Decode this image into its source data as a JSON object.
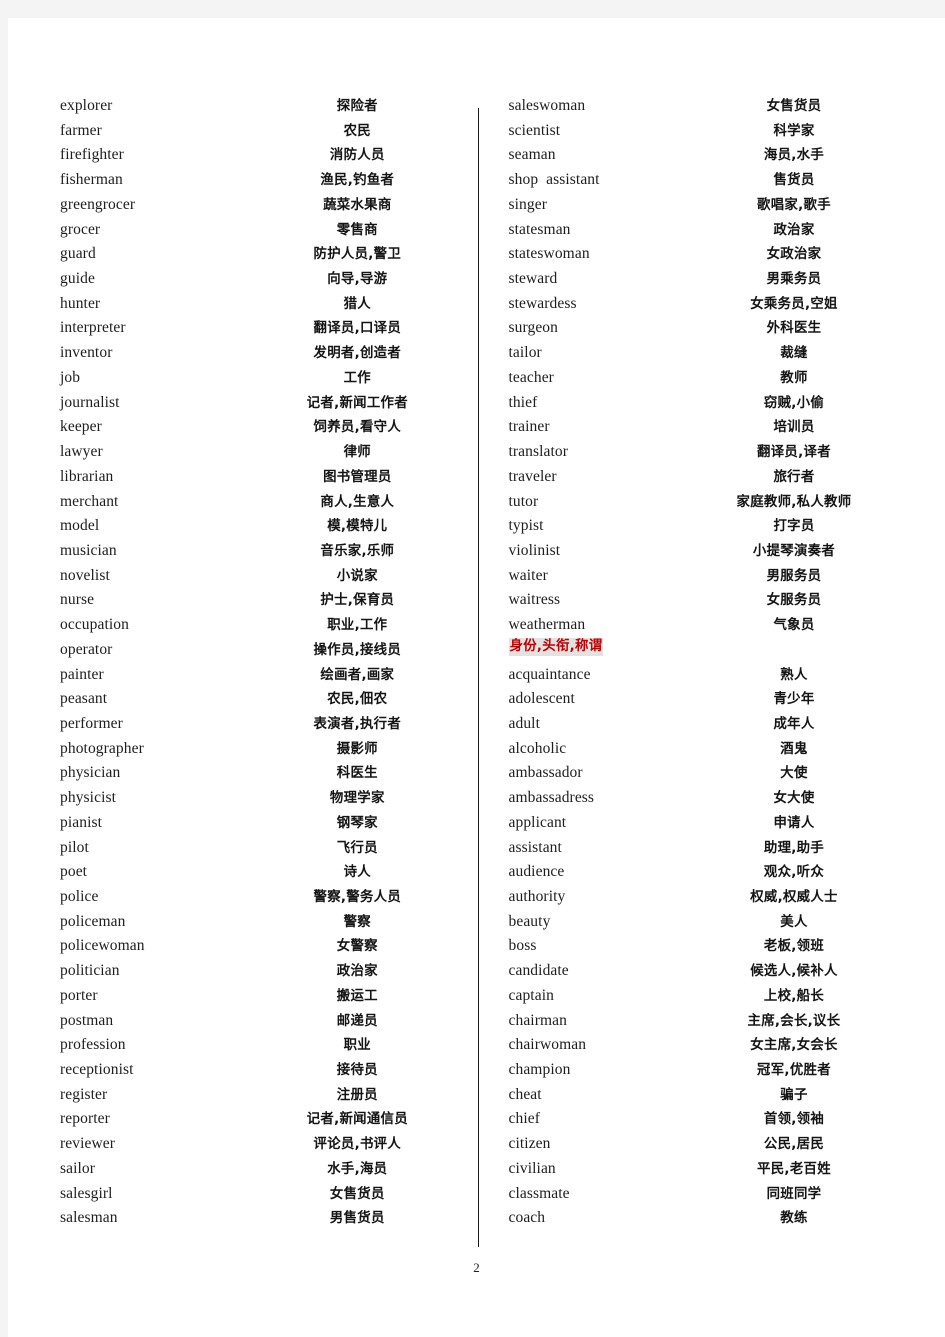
{
  "document": {
    "page_number": "2",
    "section_header": {
      "text": "身份,头衔,称谓",
      "color": "#c00000",
      "highlight": "#e2e2e2"
    }
  },
  "left_column": [
    {
      "term": "explorer",
      "gloss": "探险者"
    },
    {
      "term": "farmer",
      "gloss": "农民"
    },
    {
      "term": "firefighter",
      "gloss": "消防人员"
    },
    {
      "term": "fisherman",
      "gloss": "渔民,钓鱼者"
    },
    {
      "term": "greengrocer",
      "gloss": "蔬菜水果商"
    },
    {
      "term": "grocer",
      "gloss": "零售商"
    },
    {
      "term": "guard",
      "gloss": "防护人员,警卫"
    },
    {
      "term": "guide",
      "gloss": "向导,导游"
    },
    {
      "term": "hunter",
      "gloss": "猎人"
    },
    {
      "term": "interpreter",
      "gloss": "翻译员,口译员"
    },
    {
      "term": "inventor",
      "gloss": "发明者,创造者"
    },
    {
      "term": "job",
      "gloss": "工作"
    },
    {
      "term": "journalist",
      "gloss": "记者,新闻工作者"
    },
    {
      "term": "keeper",
      "gloss": "饲养员,看守人"
    },
    {
      "term": "lawyer",
      "gloss": "律师"
    },
    {
      "term": "librarian",
      "gloss": "图书管理员"
    },
    {
      "term": "merchant",
      "gloss": "商人,生意人"
    },
    {
      "term": "model",
      "gloss": "模,模特儿"
    },
    {
      "term": "musician",
      "gloss": "音乐家,乐师"
    },
    {
      "term": "novelist",
      "gloss": "小说家"
    },
    {
      "term": "nurse",
      "gloss": "护士,保育员"
    },
    {
      "term": "occupation",
      "gloss": "职业,工作"
    },
    {
      "term": "operator",
      "gloss": "操作员,接线员"
    },
    {
      "term": "painter",
      "gloss": "绘画者,画家"
    },
    {
      "term": "peasant",
      "gloss": "农民,佃农"
    },
    {
      "term": "performer",
      "gloss": "表演者,执行者"
    },
    {
      "term": "photographer",
      "gloss": "摄影师"
    },
    {
      "term": "physician",
      "gloss": "科医生"
    },
    {
      "term": "physicist",
      "gloss": "物理学家"
    },
    {
      "term": "pianist",
      "gloss": "钢琴家"
    },
    {
      "term": "pilot",
      "gloss": "飞行员"
    },
    {
      "term": "poet",
      "gloss": "诗人"
    },
    {
      "term": "police",
      "gloss": "警察,警务人员"
    },
    {
      "term": "policeman",
      "gloss": "警察"
    },
    {
      "term": "policewoman",
      "gloss": "女警察"
    },
    {
      "term": "politician",
      "gloss": "政治家"
    },
    {
      "term": "porter",
      "gloss": "搬运工"
    },
    {
      "term": "postman",
      "gloss": "邮递员"
    },
    {
      "term": "profession",
      "gloss": "职业"
    },
    {
      "term": "receptionist",
      "gloss": "接待员"
    },
    {
      "term": "register",
      "gloss": "注册员"
    },
    {
      "term": "reporter",
      "gloss": "记者,新闻通信员"
    },
    {
      "term": "reviewer",
      "gloss": "评论员,书评人"
    },
    {
      "term": "sailor",
      "gloss": "水手,海员"
    },
    {
      "term": "salesgirl",
      "gloss": "女售货员"
    },
    {
      "term": "salesman",
      "gloss": "男售货员"
    }
  ],
  "right_column_before_header": [
    {
      "term": "saleswoman",
      "gloss": "女售货员"
    },
    {
      "term": "scientist",
      "gloss": "科学家"
    },
    {
      "term": "seaman",
      "gloss": "海员,水手"
    },
    {
      "term": "shop  assistant",
      "gloss": "售货员"
    },
    {
      "term": "singer",
      "gloss": "歌唱家,歌手"
    },
    {
      "term": "statesman",
      "gloss": "政治家"
    },
    {
      "term": "stateswoman",
      "gloss": "女政治家"
    },
    {
      "term": "steward",
      "gloss": "男乘务员"
    },
    {
      "term": "stewardess",
      "gloss": "女乘务员,空姐"
    },
    {
      "term": "surgeon",
      "gloss": "外科医生"
    },
    {
      "term": "tailor",
      "gloss": "裁缝"
    },
    {
      "term": "teacher",
      "gloss": "教师"
    },
    {
      "term": "thief",
      "gloss": "窃贼,小偷"
    },
    {
      "term": "trainer",
      "gloss": "培训员"
    },
    {
      "term": "translator",
      "gloss": "翻译员,译者"
    },
    {
      "term": "traveler",
      "gloss": "旅行者"
    },
    {
      "term": "tutor",
      "gloss": "家庭教师,私人教师"
    },
    {
      "term": "typist",
      "gloss": "打字员"
    },
    {
      "term": "violinist",
      "gloss": "小提琴演奏者"
    },
    {
      "term": "waiter",
      "gloss": "男服务员"
    },
    {
      "term": "waitress",
      "gloss": "女服务员"
    },
    {
      "term": "weatherman",
      "gloss": "气象员"
    }
  ],
  "right_column_after_header": [
    {
      "term": "acquaintance",
      "gloss": "熟人"
    },
    {
      "term": "adolescent",
      "gloss": "青少年"
    },
    {
      "term": "adult",
      "gloss": "成年人"
    },
    {
      "term": "alcoholic",
      "gloss": "酒鬼"
    },
    {
      "term": "ambassador",
      "gloss": "大使"
    },
    {
      "term": "ambassadress",
      "gloss": "女大使"
    },
    {
      "term": "applicant",
      "gloss": "申请人"
    },
    {
      "term": "assistant",
      "gloss": "助理,助手"
    },
    {
      "term": "audience",
      "gloss": "观众,听众"
    },
    {
      "term": "authority",
      "gloss": "权威,权威人士"
    },
    {
      "term": "beauty",
      "gloss": "美人"
    },
    {
      "term": "boss",
      "gloss": "老板,领班"
    },
    {
      "term": "candidate",
      "gloss": "候选人,候补人"
    },
    {
      "term": "captain",
      "gloss": "上校,船长"
    },
    {
      "term": "chairman",
      "gloss": "主席,会长,议长"
    },
    {
      "term": "chairwoman",
      "gloss": "女主席,女会长"
    },
    {
      "term": "champion",
      "gloss": "冠军,优胜者"
    },
    {
      "term": "cheat",
      "gloss": "骗子"
    },
    {
      "term": "chief",
      "gloss": "首领,领袖"
    },
    {
      "term": "citizen",
      "gloss": "公民,居民"
    },
    {
      "term": "civilian",
      "gloss": "平民,老百姓"
    },
    {
      "term": "classmate",
      "gloss": "同班同学"
    },
    {
      "term": "coach",
      "gloss": "教练"
    }
  ]
}
